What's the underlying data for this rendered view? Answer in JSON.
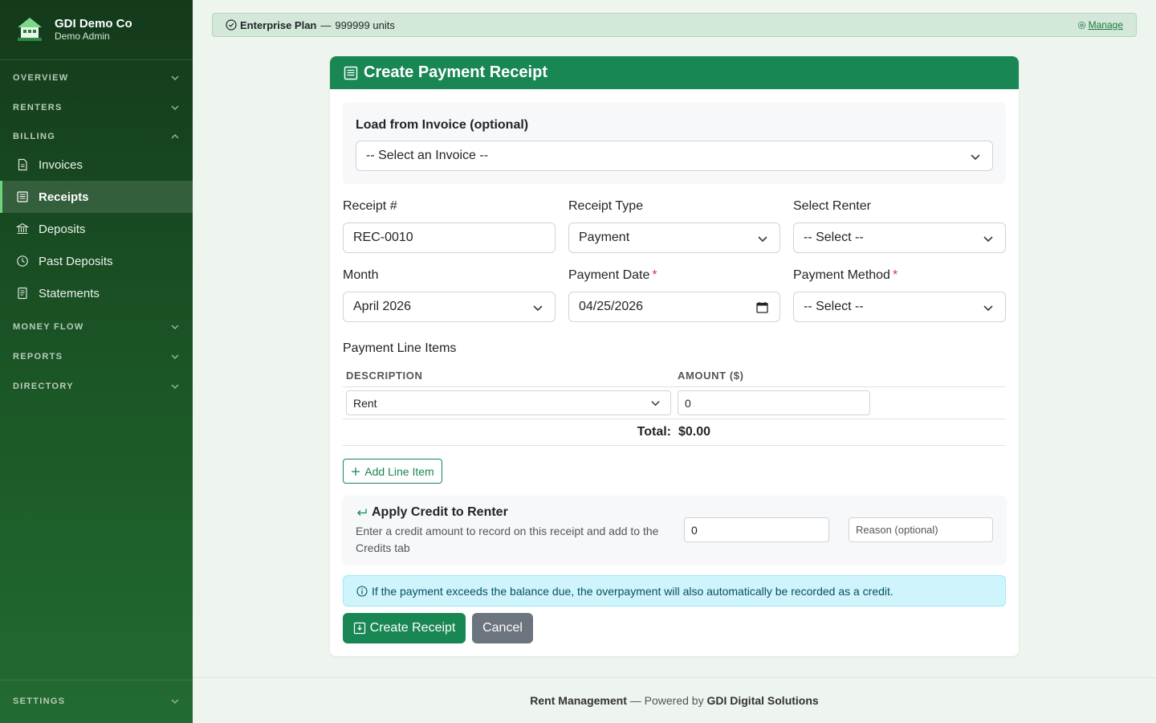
{
  "brand": {
    "name": "GDI Demo Co",
    "role": "Demo Admin"
  },
  "sidebar": {
    "sections": [
      {
        "label": "OVERVIEW"
      },
      {
        "label": "RENTERS"
      },
      {
        "label": "BILLING"
      },
      {
        "label": "MONEY FLOW"
      },
      {
        "label": "REPORTS"
      },
      {
        "label": "DIRECTORY"
      },
      {
        "label": "SETTINGS"
      }
    ],
    "billing_items": [
      {
        "label": "Invoices",
        "icon": "document-icon"
      },
      {
        "label": "Receipts",
        "icon": "receipt-icon",
        "active": true
      },
      {
        "label": "Deposits",
        "icon": "bank-icon"
      },
      {
        "label": "Past Deposits",
        "icon": "clock-history-icon"
      },
      {
        "label": "Statements",
        "icon": "file-text-icon"
      }
    ]
  },
  "plan": {
    "name": "Enterprise Plan",
    "separator": "—",
    "units": "999999 units",
    "manage_label": "Manage"
  },
  "form": {
    "title": "Create Payment Receipt",
    "invoice": {
      "label": "Load from Invoice (optional)",
      "value": "-- Select an Invoice --"
    },
    "receipt_number": {
      "label": "Receipt #",
      "value": "REC-0010"
    },
    "receipt_type": {
      "label": "Receipt Type",
      "value": "Payment"
    },
    "renter": {
      "label": "Select Renter",
      "value": "-- Select --"
    },
    "month": {
      "label": "Month",
      "value": "April 2026"
    },
    "payment_date": {
      "label": "Payment Date",
      "required": "*",
      "value": "04/25/2026"
    },
    "payment_method": {
      "label": "Payment Method",
      "required": "*",
      "value": "-- Select --"
    },
    "line_items": {
      "title": "Payment Line Items",
      "columns": [
        "DESCRIPTION",
        "AMOUNT ($)"
      ],
      "rows": [
        {
          "description": "Rent",
          "amount": "0"
        }
      ],
      "total_label": "Total:",
      "total_value": "$0.00",
      "add_label": "Add Line Item"
    },
    "credit": {
      "title": "Apply Credit to Renter",
      "description": "Enter a credit amount to record on this receipt and add to the Credits tab",
      "amount": "0",
      "reason_placeholder": "Reason (optional)"
    },
    "info": "If the payment exceeds the balance due, the overpayment will also automatically be recorded as a credit.",
    "submit_label": "Create Receipt",
    "cancel_label": "Cancel"
  },
  "footer": {
    "app": "Rent Management",
    "middle": " — Powered by ",
    "company": "GDI Digital Solutions"
  },
  "colors": {
    "primary": "#198754",
    "sidebar": "#1c5a28",
    "info_bg": "#cff4fc",
    "danger": "#dc3545"
  }
}
